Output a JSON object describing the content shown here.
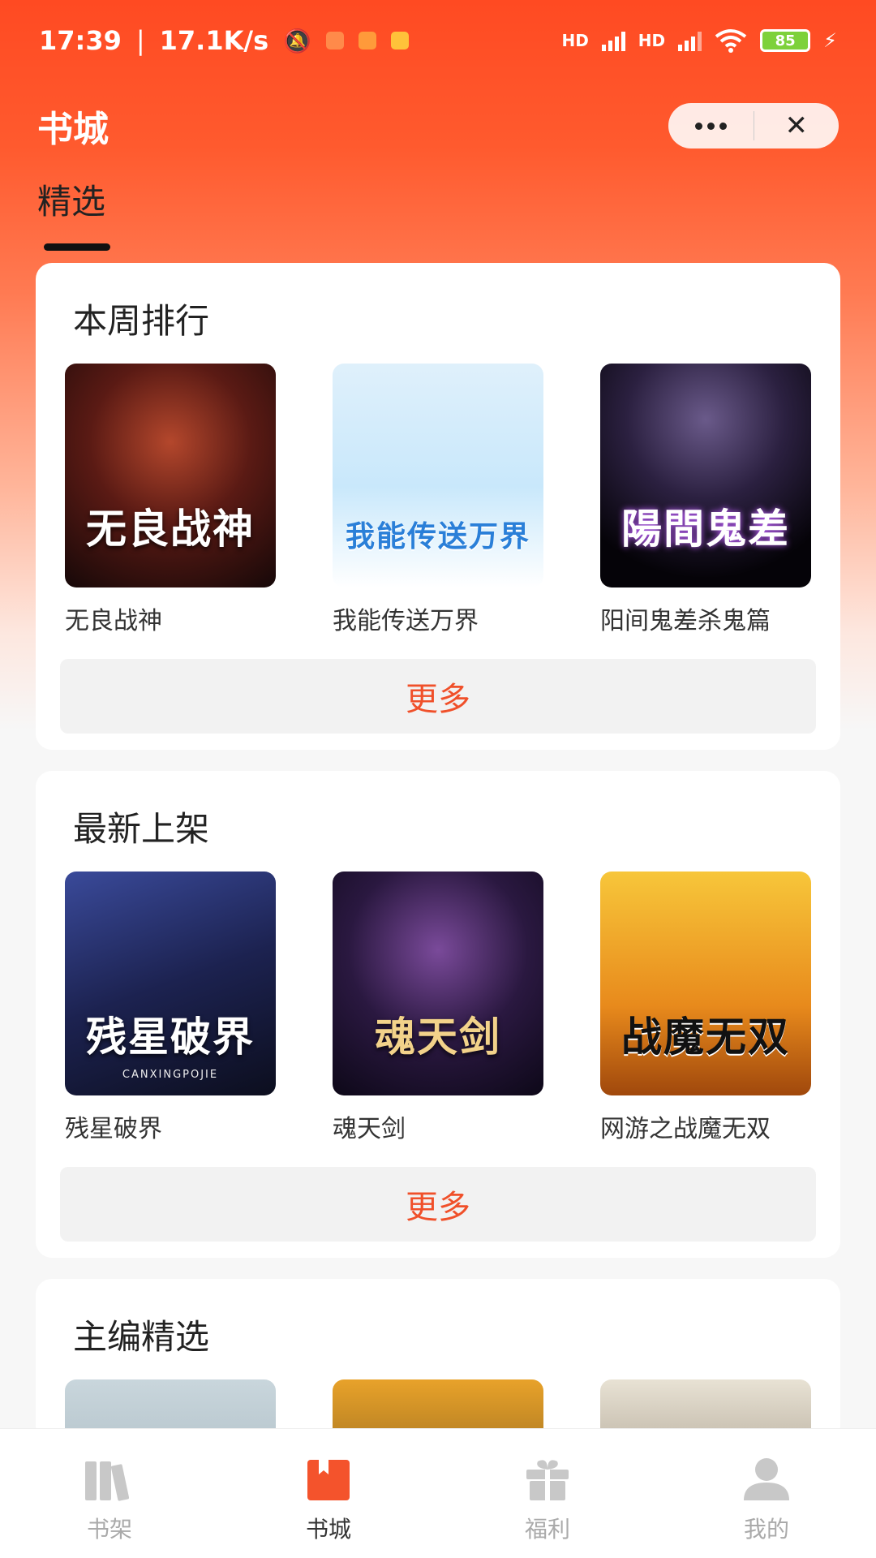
{
  "status": {
    "time": "17:39",
    "speed": "17.1K/s",
    "signal1_label": "HD",
    "signal2_label": "HD",
    "battery": "85"
  },
  "header": {
    "title": "书城",
    "capsule_more_icon": "more-dots-icon",
    "capsule_close_icon": "close-icon"
  },
  "tabs": [
    {
      "label": "精选",
      "active": true
    }
  ],
  "sections": [
    {
      "title": "本周排行",
      "more_label": "更多",
      "books": [
        {
          "name": "无良战神",
          "cover_text": "无良战神"
        },
        {
          "name": "我能传送万界",
          "cover_text": "我能传送万界"
        },
        {
          "name": "阳间鬼差杀鬼篇",
          "cover_text": "陽間鬼差"
        }
      ]
    },
    {
      "title": "最新上架",
      "more_label": "更多",
      "books": [
        {
          "name": "残星破界",
          "cover_text": "残星破界",
          "cover_sub": "CANXINGPOJIE"
        },
        {
          "name": "魂天剑",
          "cover_text": "魂天剑"
        },
        {
          "name": "网游之战魔无双",
          "cover_text": "战魔无双"
        }
      ]
    },
    {
      "title": "主编精选"
    }
  ],
  "bottom_nav": [
    {
      "label": "书架",
      "icon": "bookshelf-icon",
      "active": false
    },
    {
      "label": "书城",
      "icon": "bookstore-icon",
      "active": true
    },
    {
      "label": "福利",
      "icon": "gift-icon",
      "active": false
    },
    {
      "label": "我的",
      "icon": "profile-icon",
      "active": false
    }
  ],
  "colors": {
    "brand": "#ff4a22",
    "more_text": "#f0502a"
  }
}
